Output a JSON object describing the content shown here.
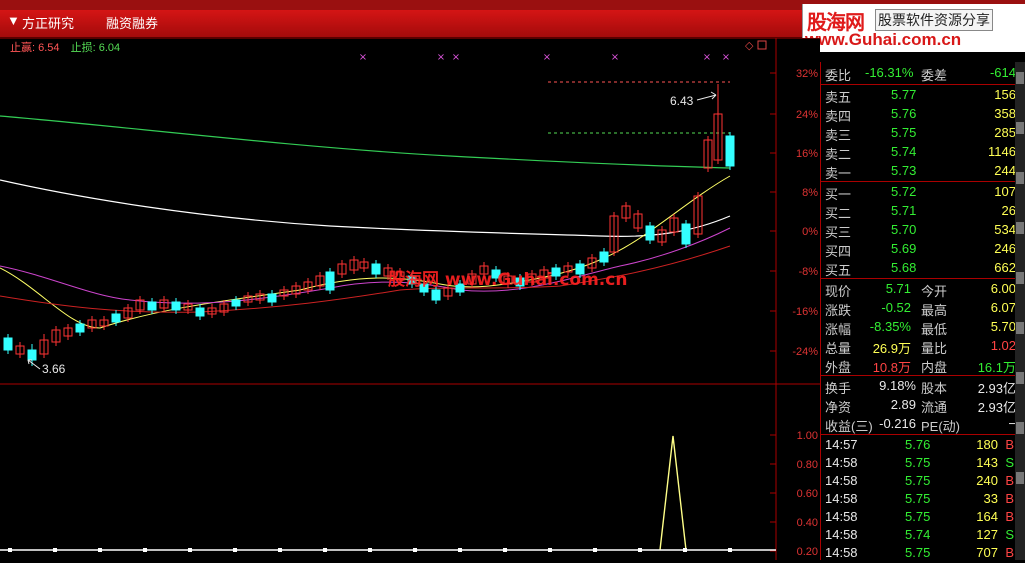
{
  "menu": {
    "items": [
      "方正研究",
      "融资融券"
    ]
  },
  "watermark": {
    "brand": "股海网",
    "tagline": "股票软件资源分享",
    "url": "www.Guhai.com.cn",
    "overlay": "股海网 www.Guhai.com.cn"
  },
  "legend": {
    "stop_profit_label": "止赢:",
    "stop_profit_value": "6.54",
    "stop_loss_label": "止损:",
    "stop_loss_value": "6.04"
  },
  "chart_data": {
    "type": "candlestick",
    "price_axis_ticks": [
      "32%",
      "24%",
      "16%",
      "8%",
      "0%",
      "-8%",
      "-16%",
      "-24%"
    ],
    "volume_axis_ticks": [
      "1.00",
      "0.80",
      "0.60",
      "0.40",
      "0.20"
    ],
    "annotations": {
      "high_label": "6.43",
      "low_label": "3.66"
    },
    "markers": [
      "×",
      "×",
      "×",
      "×",
      "×",
      "×",
      "×"
    ]
  },
  "quote": {
    "weibi_label": "委比",
    "weibi_value": "-16.31%",
    "weicha_label": "委差",
    "weicha_value": "-614",
    "asks": [
      {
        "label": "卖五",
        "price": "5.77",
        "vol": "156"
      },
      {
        "label": "卖四",
        "price": "5.76",
        "vol": "358"
      },
      {
        "label": "卖三",
        "price": "5.75",
        "vol": "285"
      },
      {
        "label": "卖二",
        "price": "5.74",
        "vol": "1146"
      },
      {
        "label": "卖一",
        "price": "5.73",
        "vol": "244"
      }
    ],
    "bids": [
      {
        "label": "买一",
        "price": "5.72",
        "vol": "107"
      },
      {
        "label": "买二",
        "price": "5.71",
        "vol": "26"
      },
      {
        "label": "买三",
        "price": "5.70",
        "vol": "534"
      },
      {
        "label": "买四",
        "price": "5.69",
        "vol": "246"
      },
      {
        "label": "买五",
        "price": "5.68",
        "vol": "662"
      }
    ],
    "stats": [
      {
        "l1": "现价",
        "v1": "5.71",
        "c1": "green",
        "l2": "今开",
        "v2": "6.00",
        "c2": "yellow"
      },
      {
        "l1": "涨跌",
        "v1": "-0.52",
        "c1": "green",
        "l2": "最高",
        "v2": "6.07",
        "c2": "yellow"
      },
      {
        "l1": "涨幅",
        "v1": "-8.35%",
        "c1": "green",
        "l2": "最低",
        "v2": "5.70",
        "c2": "yellow"
      },
      {
        "l1": "总量",
        "v1": "26.9万",
        "c1": "yellow",
        "l2": "量比",
        "v2": "1.02",
        "c2": "red"
      },
      {
        "l1": "外盘",
        "v1": "10.8万",
        "c1": "red",
        "l2": "内盘",
        "v2": "16.1万",
        "c2": "green"
      }
    ],
    "fund": [
      {
        "l1": "换手",
        "v1": "9.18%",
        "l2": "股本",
        "v2": "2.93亿"
      },
      {
        "l1": "净资",
        "v1": "2.89",
        "l2": "流通",
        "v2": "2.93亿"
      },
      {
        "l1": "收益(三)",
        "v1": "-0.216",
        "l2": "PE(动)",
        "v2": "−"
      }
    ],
    "ticks": [
      {
        "time": "14:57",
        "price": "5.76",
        "vol": "180",
        "side": "B"
      },
      {
        "time": "14:58",
        "price": "5.75",
        "vol": "143",
        "side": "S"
      },
      {
        "time": "14:58",
        "price": "5.75",
        "vol": "240",
        "side": "B"
      },
      {
        "time": "14:58",
        "price": "5.75",
        "vol": "33",
        "side": "B"
      },
      {
        "time": "14:58",
        "price": "5.75",
        "vol": "164",
        "side": "B"
      },
      {
        "time": "14:58",
        "price": "5.74",
        "vol": "127",
        "side": "S"
      },
      {
        "time": "14:58",
        "price": "5.75",
        "vol": "707",
        "side": "B"
      }
    ],
    "colors": {
      "up": "#ff3333",
      "down": "#33ffff",
      "ma_white": "#ffffff",
      "ma_yellow": "#ffff66",
      "ma_green": "#33cc55",
      "ma_magenta": "#cc44cc",
      "ma_red": "#cc2222"
    }
  }
}
